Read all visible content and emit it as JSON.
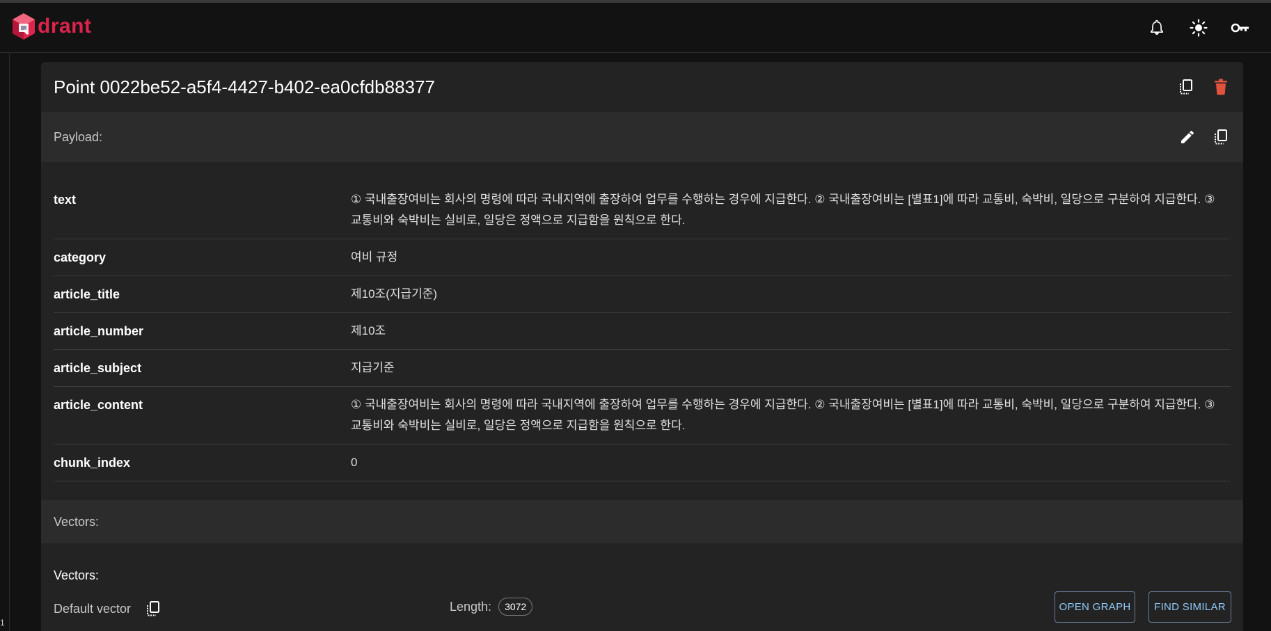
{
  "app": {
    "logo_text": "drant",
    "brand_color": "#dc244c"
  },
  "header": {
    "icons": [
      "bell-icon",
      "sun-icon",
      "key-icon"
    ]
  },
  "sidebar": {
    "digit": "1"
  },
  "point": {
    "title": "Point 0022be52-a5f4-4427-b402-ea0cfdb88377"
  },
  "payload": {
    "label": "Payload:",
    "rows": [
      {
        "key": "text",
        "value": "① 국내출장여비는 회사의 명령에 따라 국내지역에 출장하여 업무를 수행하는 경우에 지급한다. ② 국내출장여비는 [별표1]에 따라 교통비, 숙박비, 일당으로 구분하여 지급한다. ③ 교통비와 숙박비는 실비로, 일당은 정액으로 지급함을 원칙으로 한다."
      },
      {
        "key": "category",
        "value": "여비 규정"
      },
      {
        "key": "article_title",
        "value": "제10조(지급기준)"
      },
      {
        "key": "article_number",
        "value": "제10조"
      },
      {
        "key": "article_subject",
        "value": "지급기준"
      },
      {
        "key": "article_content",
        "value": "① 국내출장여비는 회사의 명령에 따라 국내지역에 출장하여 업무를 수행하는 경우에 지급한다. ② 국내출장여비는 [별표1]에 따라 교통비, 숙박비, 일당으로 구분하여 지급한다. ③ 교통비와 숙박비는 실비로, 일당은 정액으로 지급함을 원칙으로 한다."
      },
      {
        "key": "chunk_index",
        "value": "0"
      }
    ]
  },
  "vectors": {
    "section_label": "Vectors:",
    "sub_label": "Vectors:",
    "default_vector_label": "Default vector",
    "length_label": "Length:",
    "length_value": "3072",
    "open_graph_label": "OPEN GRAPH",
    "find_similar_label": "FIND SIMILAR"
  },
  "colors": {
    "background": "#121212",
    "card": "#232323",
    "section": "#2c2c2c",
    "delete": "#e0533d",
    "accent_button": "#90caf9"
  }
}
